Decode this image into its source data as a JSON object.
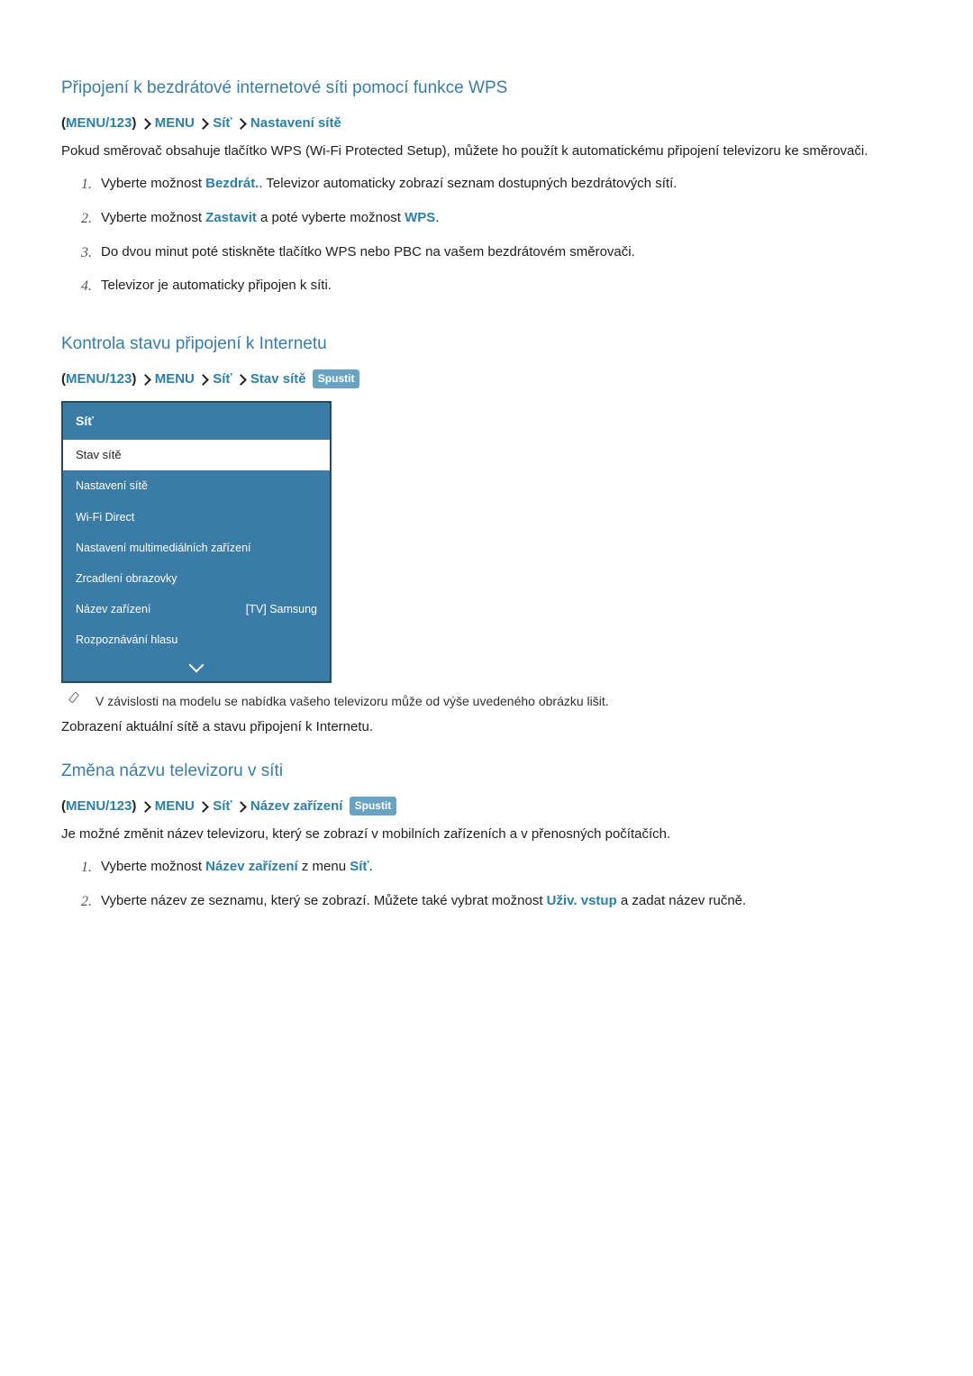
{
  "section1": {
    "title": "Připojení k bezdrátové internetové síti pomocí funkce WPS",
    "breadcrumb": {
      "paren_open": "(",
      "btn": "MENU/123",
      "paren_close": ")",
      "parts": [
        "MENU",
        "Síť",
        "Nastavení sítě"
      ]
    },
    "intro": "Pokud směrovač obsahuje tlačítko WPS (Wi-Fi Protected Setup), můžete ho použít k automatickému připojení televizoru ke směrovači.",
    "steps": [
      {
        "num": "1.",
        "pre": "Vyberte možnost ",
        "link1": "Bezdrát.",
        "post1": ". Televizor automaticky zobrazí seznam dostupných bezdrátových sítí."
      },
      {
        "num": "2.",
        "pre": "Vyberte možnost ",
        "link1": "Zastavit",
        "mid": " a poté vyberte možnost ",
        "link2": "WPS",
        "post2": "."
      },
      {
        "num": "3.",
        "pre": "Do dvou minut poté stiskněte tlačítko WPS nebo PBC na vašem bezdrátovém směrovači."
      },
      {
        "num": "4.",
        "pre": "Televizor je automaticky připojen k síti."
      }
    ]
  },
  "section2": {
    "title": "Kontrola stavu připojení k Internetu",
    "breadcrumb": {
      "paren_open": "(",
      "btn": "MENU/123",
      "paren_close": ")",
      "parts": [
        "MENU",
        "Síť",
        "Stav sítě"
      ],
      "tag": "Spustit"
    },
    "menu": {
      "title": "Síť",
      "active": "Stav sítě",
      "rows": [
        {
          "label": "Nastavení sítě",
          "value": ""
        },
        {
          "label": "Wi-Fi Direct",
          "value": ""
        },
        {
          "label": "Nastavení multimediálních zařízení",
          "value": ""
        },
        {
          "label": "Zrcadlení obrazovky",
          "value": ""
        },
        {
          "label": "Název zařízení",
          "value": "[TV] Samsung"
        },
        {
          "label": "Rozpoznávání hlasu",
          "value": ""
        }
      ]
    },
    "note": "V závislosti na modelu se nabídka vašeho televizoru může od výše uvedeného obrázku lišit.",
    "body": "Zobrazení aktuální sítě a stavu připojení k Internetu."
  },
  "section3": {
    "title": "Změna názvu televizoru v síti",
    "breadcrumb": {
      "paren_open": "(",
      "btn": "MENU/123",
      "paren_close": ")",
      "parts": [
        "MENU",
        "Síť",
        "Název zařízení"
      ],
      "tag": "Spustit"
    },
    "intro": "Je možné změnit název televizoru, který se zobrazí v mobilních zařízeních a v přenosných počítačích.",
    "steps": [
      {
        "num": "1.",
        "pre": "Vyberte možnost ",
        "link1": "Název zařízení",
        "mid": " z menu ",
        "link2": "Síť",
        "post2": "."
      },
      {
        "num": "2.",
        "pre": "Vyberte název ze seznamu, který se zobrazí. Můžete také vybrat možnost ",
        "link1": "Uživ. vstup",
        "post1": " a zadat název ručně."
      }
    ]
  }
}
